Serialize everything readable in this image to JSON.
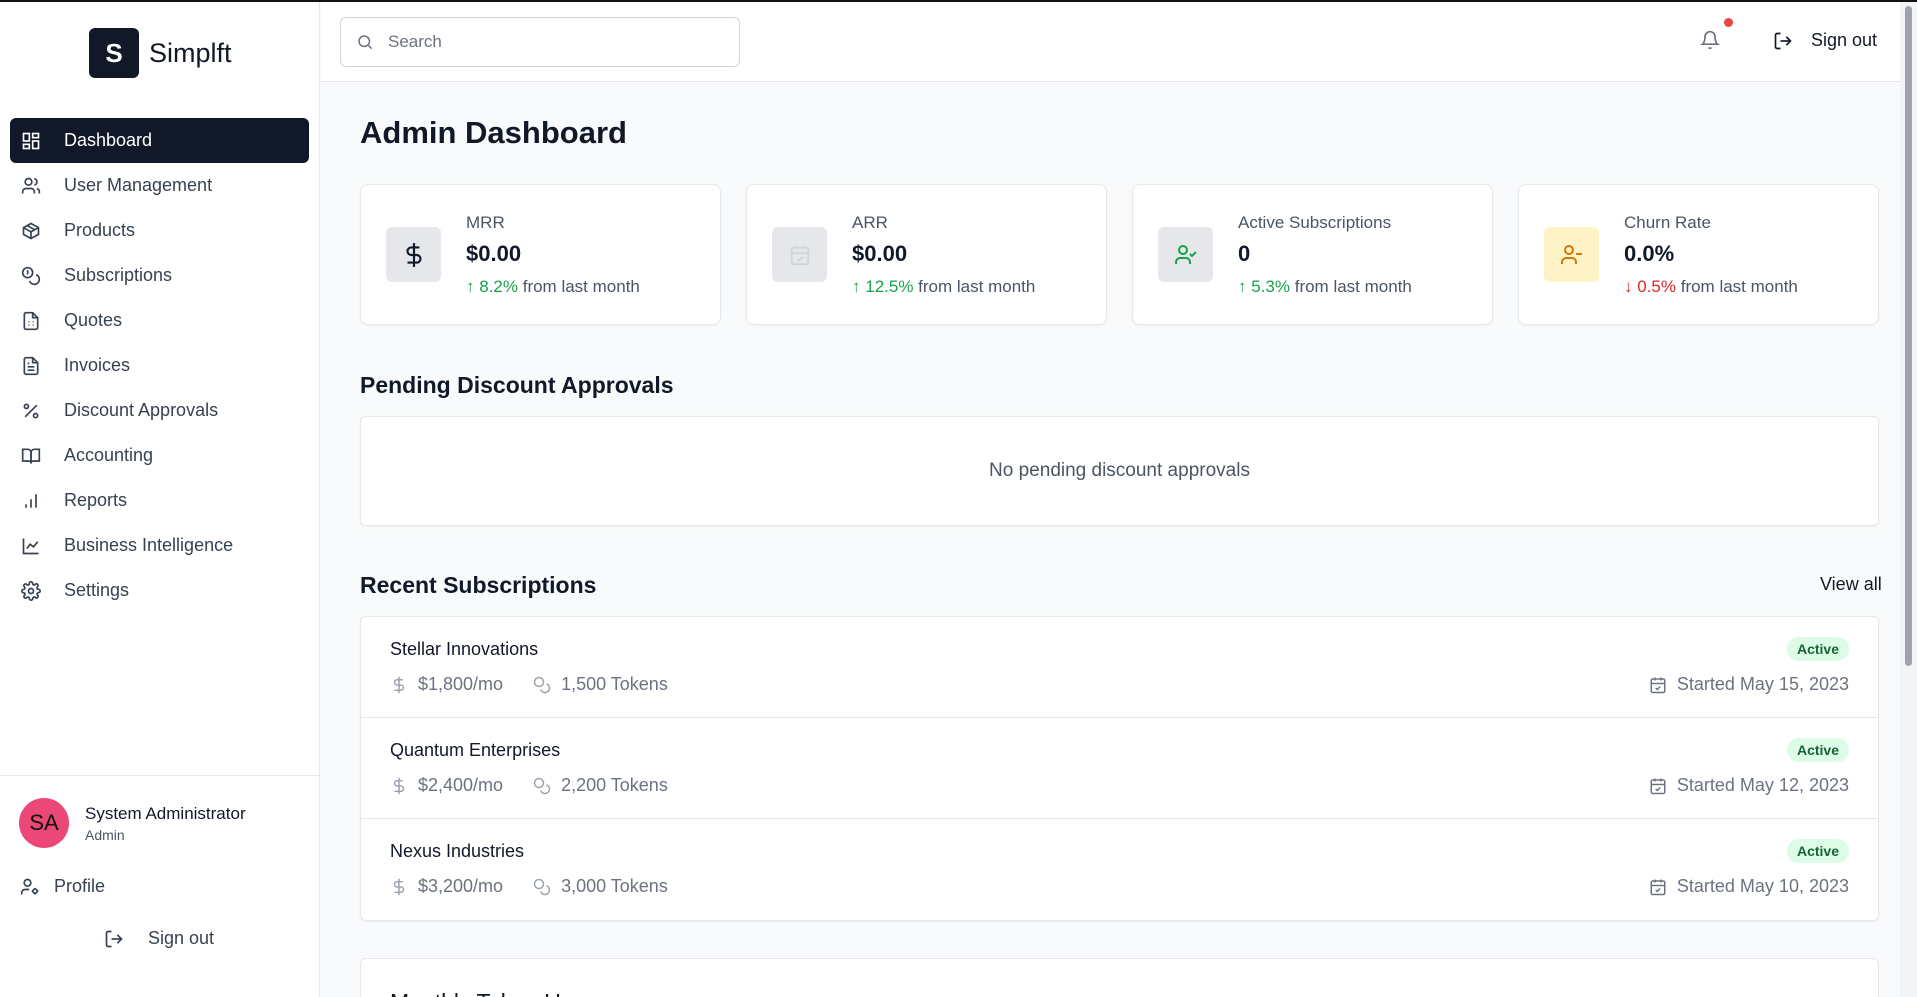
{
  "brand": {
    "logo_letter": "S",
    "name": "Simplft"
  },
  "sidebar": {
    "items": [
      {
        "label": "Dashboard",
        "icon": "dashboard-icon",
        "active": true
      },
      {
        "label": "User Management",
        "icon": "users-icon"
      },
      {
        "label": "Products",
        "icon": "package-icon"
      },
      {
        "label": "Subscriptions",
        "icon": "coins-icon"
      },
      {
        "label": "Quotes",
        "icon": "file-text-icon"
      },
      {
        "label": "Invoices",
        "icon": "file-icon"
      },
      {
        "label": "Discount Approvals",
        "icon": "percent-icon"
      },
      {
        "label": "Accounting",
        "icon": "book-icon"
      },
      {
        "label": "Reports",
        "icon": "bar-chart-icon"
      },
      {
        "label": "Business Intelligence",
        "icon": "line-chart-icon"
      },
      {
        "label": "Settings",
        "icon": "gear-icon"
      }
    ],
    "user": {
      "initials": "SA",
      "name": "System Administrator",
      "role": "Admin",
      "avatar_color": "#ec4877"
    },
    "profile_label": "Profile",
    "signout_label": "Sign out"
  },
  "header": {
    "search_placeholder": "Search",
    "search_value": "",
    "signout_label": "Sign out",
    "notification_dot_color": "#ef4444"
  },
  "main": {
    "title": "Admin Dashboard",
    "stats": [
      {
        "label": "MRR",
        "value": "$0.00",
        "change": "8.2%",
        "arrow": "↑",
        "suffix": "from last month",
        "direction": "up",
        "icon": "dollar-icon",
        "icon_bg": "#e5e7eb"
      },
      {
        "label": "ARR",
        "value": "$0.00",
        "change": "12.5%",
        "arrow": "↑",
        "suffix": "from last month",
        "direction": "up",
        "icon": "calendar-check-icon",
        "icon_bg": "#e5e7eb"
      },
      {
        "label": "Active Subscriptions",
        "value": "0",
        "change": "5.3%",
        "arrow": "↑",
        "suffix": "from last month",
        "direction": "up",
        "icon": "user-check-icon",
        "icon_bg": "#e5e7eb"
      },
      {
        "label": "Churn Rate",
        "value": "0.0%",
        "change": "0.5%",
        "arrow": "↓",
        "suffix": "from last month",
        "direction": "down",
        "icon": "user-minus-icon",
        "icon_bg": "#fef3c7"
      }
    ],
    "pending": {
      "title": "Pending Discount Approvals",
      "empty_text": "No pending discount approvals"
    },
    "recent": {
      "title": "Recent Subscriptions",
      "view_all": "View all",
      "rows": [
        {
          "name": "Stellar Innovations",
          "price": "$1,800/mo",
          "tokens": "1,500 Tokens",
          "status": "Active",
          "started": "Started May 15, 2023"
        },
        {
          "name": "Quantum Enterprises",
          "price": "$2,400/mo",
          "tokens": "2,200 Tokens",
          "status": "Active",
          "started": "Started May 12, 2023"
        },
        {
          "name": "Nexus Industries",
          "price": "$3,200/mo",
          "tokens": "3,000 Tokens",
          "status": "Active",
          "started": "Started May 10, 2023"
        }
      ]
    },
    "bottom_card_title": "Monthly Token Usage"
  },
  "colors": {
    "accent": "#111827",
    "up": "#16a34a",
    "down": "#dc2626",
    "badge_bg": "#dcfce7",
    "badge_text": "#166534"
  }
}
